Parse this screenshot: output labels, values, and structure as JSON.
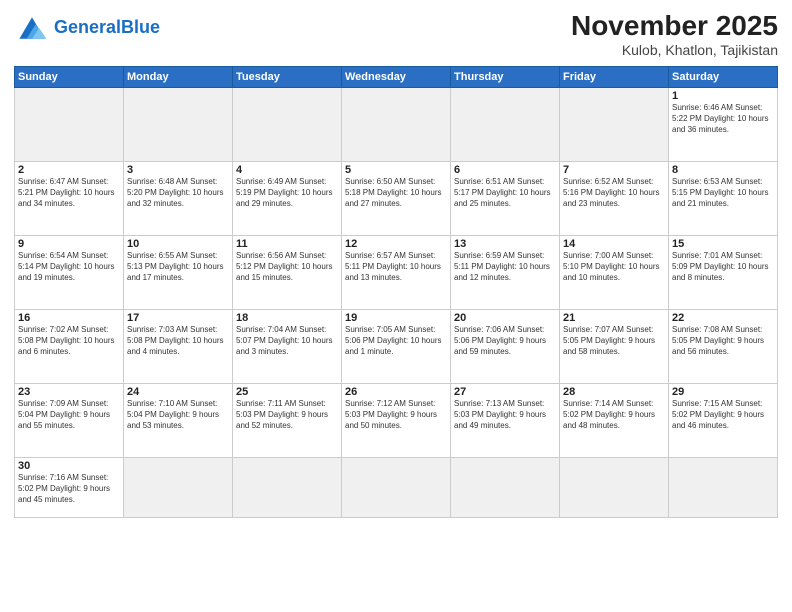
{
  "header": {
    "logo_general": "General",
    "logo_blue": "Blue",
    "title": "November 2025",
    "subtitle": "Kulob, Khatlon, Tajikistan"
  },
  "weekdays": [
    "Sunday",
    "Monday",
    "Tuesday",
    "Wednesday",
    "Thursday",
    "Friday",
    "Saturday"
  ],
  "weeks": [
    [
      {
        "day": "",
        "info": ""
      },
      {
        "day": "",
        "info": ""
      },
      {
        "day": "",
        "info": ""
      },
      {
        "day": "",
        "info": ""
      },
      {
        "day": "",
        "info": ""
      },
      {
        "day": "",
        "info": ""
      },
      {
        "day": "1",
        "info": "Sunrise: 6:46 AM\nSunset: 5:22 PM\nDaylight: 10 hours and 36 minutes."
      }
    ],
    [
      {
        "day": "2",
        "info": "Sunrise: 6:47 AM\nSunset: 5:21 PM\nDaylight: 10 hours and 34 minutes."
      },
      {
        "day": "3",
        "info": "Sunrise: 6:48 AM\nSunset: 5:20 PM\nDaylight: 10 hours and 32 minutes."
      },
      {
        "day": "4",
        "info": "Sunrise: 6:49 AM\nSunset: 5:19 PM\nDaylight: 10 hours and 29 minutes."
      },
      {
        "day": "5",
        "info": "Sunrise: 6:50 AM\nSunset: 5:18 PM\nDaylight: 10 hours and 27 minutes."
      },
      {
        "day": "6",
        "info": "Sunrise: 6:51 AM\nSunset: 5:17 PM\nDaylight: 10 hours and 25 minutes."
      },
      {
        "day": "7",
        "info": "Sunrise: 6:52 AM\nSunset: 5:16 PM\nDaylight: 10 hours and 23 minutes."
      },
      {
        "day": "8",
        "info": "Sunrise: 6:53 AM\nSunset: 5:15 PM\nDaylight: 10 hours and 21 minutes."
      }
    ],
    [
      {
        "day": "9",
        "info": "Sunrise: 6:54 AM\nSunset: 5:14 PM\nDaylight: 10 hours and 19 minutes."
      },
      {
        "day": "10",
        "info": "Sunrise: 6:55 AM\nSunset: 5:13 PM\nDaylight: 10 hours and 17 minutes."
      },
      {
        "day": "11",
        "info": "Sunrise: 6:56 AM\nSunset: 5:12 PM\nDaylight: 10 hours and 15 minutes."
      },
      {
        "day": "12",
        "info": "Sunrise: 6:57 AM\nSunset: 5:11 PM\nDaylight: 10 hours and 13 minutes."
      },
      {
        "day": "13",
        "info": "Sunrise: 6:59 AM\nSunset: 5:11 PM\nDaylight: 10 hours and 12 minutes."
      },
      {
        "day": "14",
        "info": "Sunrise: 7:00 AM\nSunset: 5:10 PM\nDaylight: 10 hours and 10 minutes."
      },
      {
        "day": "15",
        "info": "Sunrise: 7:01 AM\nSunset: 5:09 PM\nDaylight: 10 hours and 8 minutes."
      }
    ],
    [
      {
        "day": "16",
        "info": "Sunrise: 7:02 AM\nSunset: 5:08 PM\nDaylight: 10 hours and 6 minutes."
      },
      {
        "day": "17",
        "info": "Sunrise: 7:03 AM\nSunset: 5:08 PM\nDaylight: 10 hours and 4 minutes."
      },
      {
        "day": "18",
        "info": "Sunrise: 7:04 AM\nSunset: 5:07 PM\nDaylight: 10 hours and 3 minutes."
      },
      {
        "day": "19",
        "info": "Sunrise: 7:05 AM\nSunset: 5:06 PM\nDaylight: 10 hours and 1 minute."
      },
      {
        "day": "20",
        "info": "Sunrise: 7:06 AM\nSunset: 5:06 PM\nDaylight: 9 hours and 59 minutes."
      },
      {
        "day": "21",
        "info": "Sunrise: 7:07 AM\nSunset: 5:05 PM\nDaylight: 9 hours and 58 minutes."
      },
      {
        "day": "22",
        "info": "Sunrise: 7:08 AM\nSunset: 5:05 PM\nDaylight: 9 hours and 56 minutes."
      }
    ],
    [
      {
        "day": "23",
        "info": "Sunrise: 7:09 AM\nSunset: 5:04 PM\nDaylight: 9 hours and 55 minutes."
      },
      {
        "day": "24",
        "info": "Sunrise: 7:10 AM\nSunset: 5:04 PM\nDaylight: 9 hours and 53 minutes."
      },
      {
        "day": "25",
        "info": "Sunrise: 7:11 AM\nSunset: 5:03 PM\nDaylight: 9 hours and 52 minutes."
      },
      {
        "day": "26",
        "info": "Sunrise: 7:12 AM\nSunset: 5:03 PM\nDaylight: 9 hours and 50 minutes."
      },
      {
        "day": "27",
        "info": "Sunrise: 7:13 AM\nSunset: 5:03 PM\nDaylight: 9 hours and 49 minutes."
      },
      {
        "day": "28",
        "info": "Sunrise: 7:14 AM\nSunset: 5:02 PM\nDaylight: 9 hours and 48 minutes."
      },
      {
        "day": "29",
        "info": "Sunrise: 7:15 AM\nSunset: 5:02 PM\nDaylight: 9 hours and 46 minutes."
      }
    ],
    [
      {
        "day": "30",
        "info": "Sunrise: 7:16 AM\nSunset: 5:02 PM\nDaylight: 9 hours and 45 minutes."
      },
      {
        "day": "",
        "info": ""
      },
      {
        "day": "",
        "info": ""
      },
      {
        "day": "",
        "info": ""
      },
      {
        "day": "",
        "info": ""
      },
      {
        "day": "",
        "info": ""
      },
      {
        "day": "",
        "info": ""
      }
    ]
  ]
}
